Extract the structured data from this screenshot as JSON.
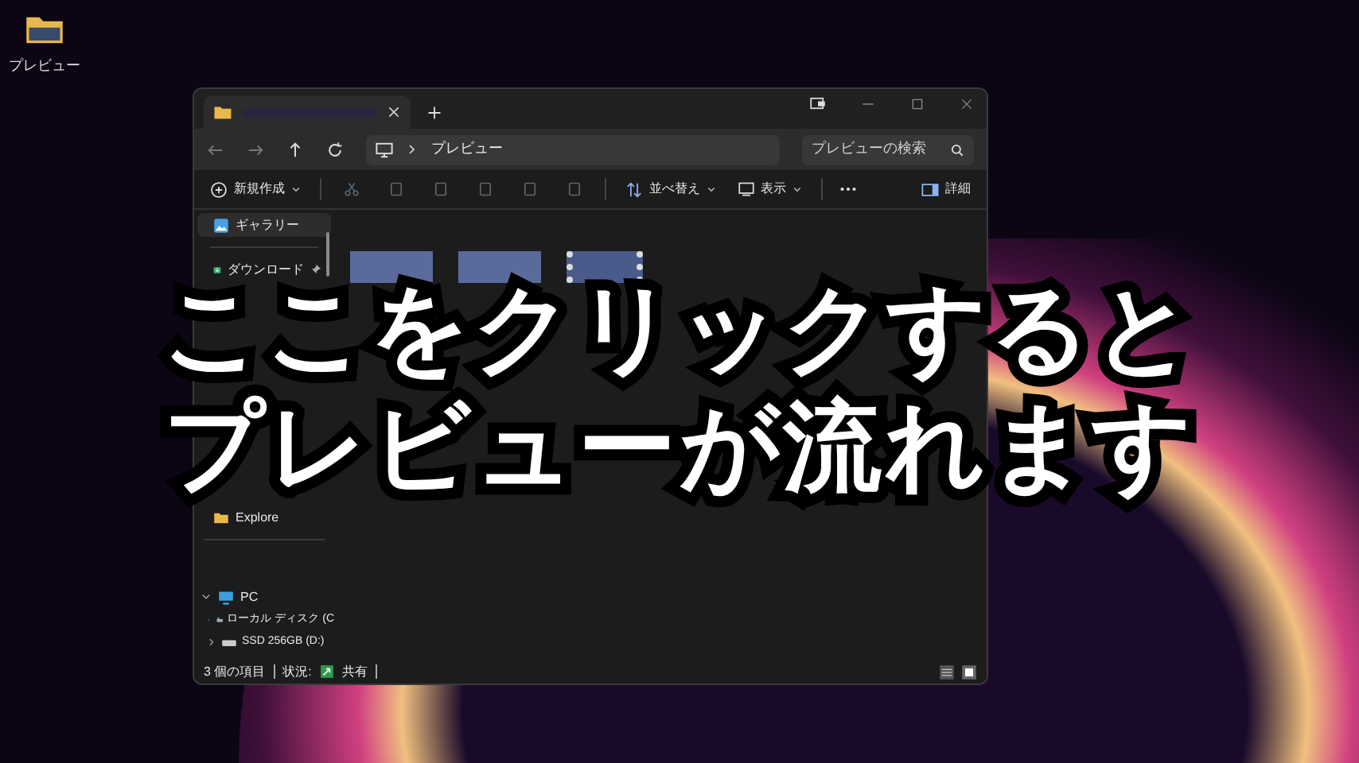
{
  "desktop_icon": {
    "label": "プレビュー"
  },
  "tab": {
    "selected": true
  },
  "address": {
    "crumb": "プレビュー",
    "search_placeholder": "プレビューの検索"
  },
  "toolbar": {
    "new": "新規作成",
    "sort": "並べ替え",
    "view": "表示",
    "details": "詳細"
  },
  "sidebar": {
    "items": [
      {
        "label": "ギャラリー",
        "pinned": false,
        "selected": true
      },
      {
        "label": "ダウンロード",
        "pinned": true,
        "selected": false
      },
      {
        "label": "Explore",
        "pinned": false,
        "selected": false
      }
    ],
    "pc": {
      "label": "PC",
      "expanded": true,
      "drives": [
        {
          "label": "ローカル ディスク (C"
        },
        {
          "label": "SSD 256GB (D:)"
        }
      ]
    }
  },
  "files": [
    {
      "kind": "image"
    },
    {
      "kind": "image"
    },
    {
      "kind": "video"
    }
  ],
  "status_bar": {
    "count": "3 個の項目",
    "state_label": "状況:",
    "state": "共有"
  },
  "caption": [
    "ここをクリックすると",
    "プレビューが流れます"
  ]
}
